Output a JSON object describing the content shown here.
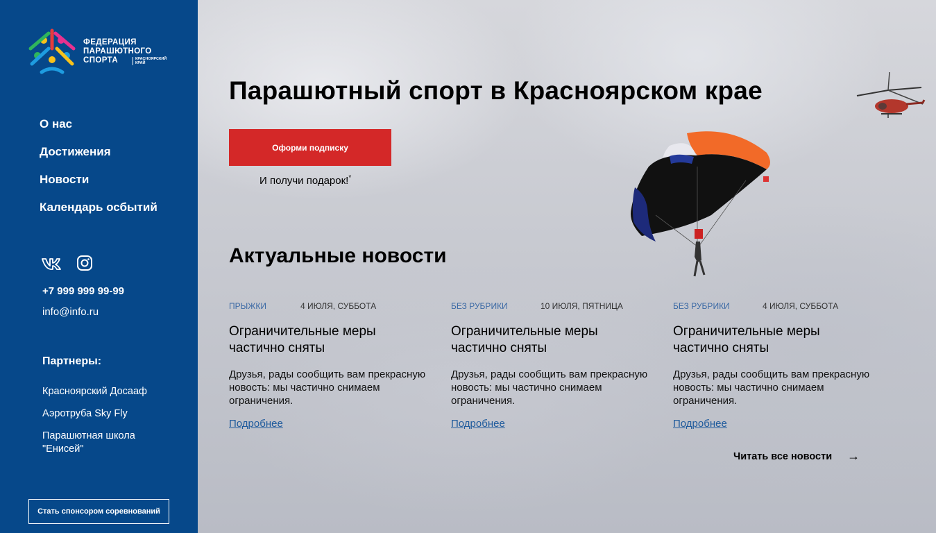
{
  "sidebar": {
    "logo": {
      "line1": "Федерация",
      "line2": "парашютного",
      "line3": "спорта",
      "sub": "Красноярский край"
    },
    "nav": [
      "О нас",
      "Достижения",
      "Новости",
      "Календарь осбытий"
    ],
    "socials": [
      "vk-icon",
      "instagram-icon"
    ],
    "phone": "+7 999 999 99-99",
    "email": "info@info.ru",
    "partners_title": "Партнеры:",
    "partners": [
      "Красноярский Досааф",
      "Аэротруба Sky Fly",
      "Парашютная школа \"Енисей\""
    ],
    "sponsor_button": "Стать спонсором соревнований"
  },
  "hero": {
    "title": "Парашютный спорт в Красноярском крае",
    "cta_button": "Оформи подписку",
    "gift_text": "И получи подарок!",
    "gift_mark": "*"
  },
  "news": {
    "title": "Актуальные новости",
    "cards": [
      {
        "category": "ПРЫЖКИ",
        "date": "4 ИЮЛЯ, СУББОТА",
        "headline": "Ограничительные меры частично сняты",
        "body": "Друзья, рады сообщить вам прекрасную новость: мы частично снимаем ограничения.",
        "link": "Подробнее"
      },
      {
        "category": "БЕЗ РУБРИКИ",
        "date": "10 ИЮЛЯ, ПЯТНИЦА",
        "headline": "Ограничительные меры частично сняты",
        "body": "Друзья, рады сообщить вам прекрасную новость: мы частично снимаем ограничения.",
        "link": "Подробнее"
      },
      {
        "category": "БЕЗ РУБРИКИ",
        "date": "4 ИЮЛЯ, СУББОТА",
        "headline": "Ограничительные меры частично сняты",
        "body": "Друзья, рады сообщить вам прекрасную новость: мы частично снимаем ограничения.",
        "link": "Подробнее"
      }
    ],
    "read_all": "Читать все новости",
    "read_all_arrow": "→"
  },
  "colors": {
    "sidebar": "#06488a",
    "cta": "#d42828",
    "category": "#3c6aa5",
    "link": "#1e5a9c"
  }
}
